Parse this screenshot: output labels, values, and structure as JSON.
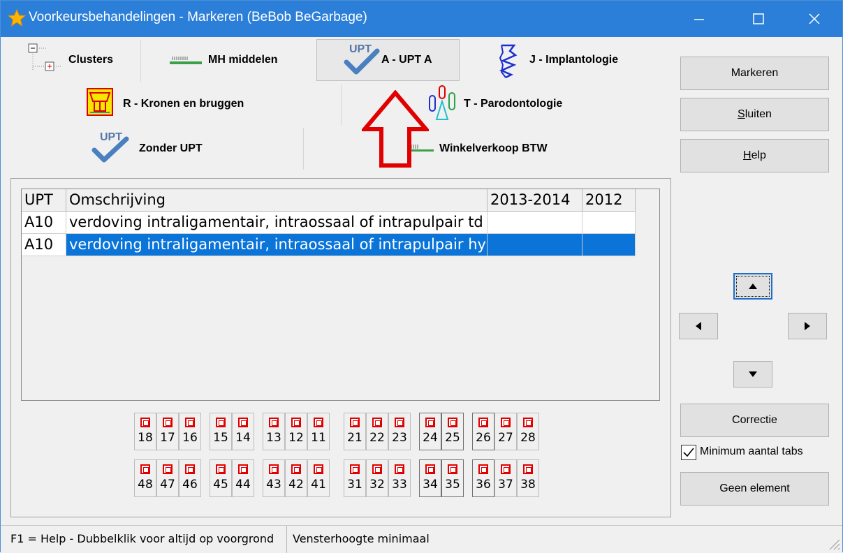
{
  "window": {
    "title": "Voorkeursbehandelingen - Markeren (BeBob BeGarbage)"
  },
  "tabs": {
    "clusters": "Clusters",
    "mh": "MH middelen",
    "upt_a": "A - UPT A",
    "implant": "J - Implantologie",
    "kronen": "R - Kronen en bruggen",
    "parodont": "T - Parodontologie",
    "zonder": "Zonder UPT",
    "winkel": "Winkelverkoop BTW",
    "upt_icon_text": "UPT"
  },
  "buttons": {
    "markeren": "Markeren",
    "sluiten_u": "S",
    "sluiten_rest": "luiten",
    "help_u": "H",
    "help_rest": "elp",
    "correctie": "Correctie",
    "geen_element": "Geen element"
  },
  "checkbox": {
    "label": "Minimum aantal tabs",
    "checked": true
  },
  "table": {
    "headers": [
      "UPT",
      "Omschrijving",
      "2013-2014",
      "2012"
    ],
    "rows": [
      {
        "upt": "A10",
        "desc": "verdoving intraligamentair, intraossaal of intrapulpair td",
        "y1": "",
        "y2": "",
        "selected": false
      },
      {
        "upt": "A10",
        "desc": "verdoving intraligamentair, intraossaal of intrapulpair hy",
        "y1": "",
        "y2": "",
        "selected": true
      }
    ]
  },
  "teeth": {
    "upper": [
      "18",
      "17",
      "16",
      "15",
      "14",
      "13",
      "12",
      "11",
      "21",
      "22",
      "23",
      "24",
      "25",
      "26",
      "27",
      "28"
    ],
    "lower": [
      "48",
      "47",
      "46",
      "45",
      "44",
      "43",
      "42",
      "41",
      "31",
      "32",
      "33",
      "34",
      "35",
      "36",
      "37",
      "38"
    ]
  },
  "status": {
    "left": "F1 = Help - Dubbelklik voor altijd op voorgrond",
    "right": "Vensterhoogte minimaal"
  },
  "colors": {
    "titlebar": "#2c7fd8",
    "selection": "#0a74d9",
    "annotation_arrow": "#e00000"
  }
}
